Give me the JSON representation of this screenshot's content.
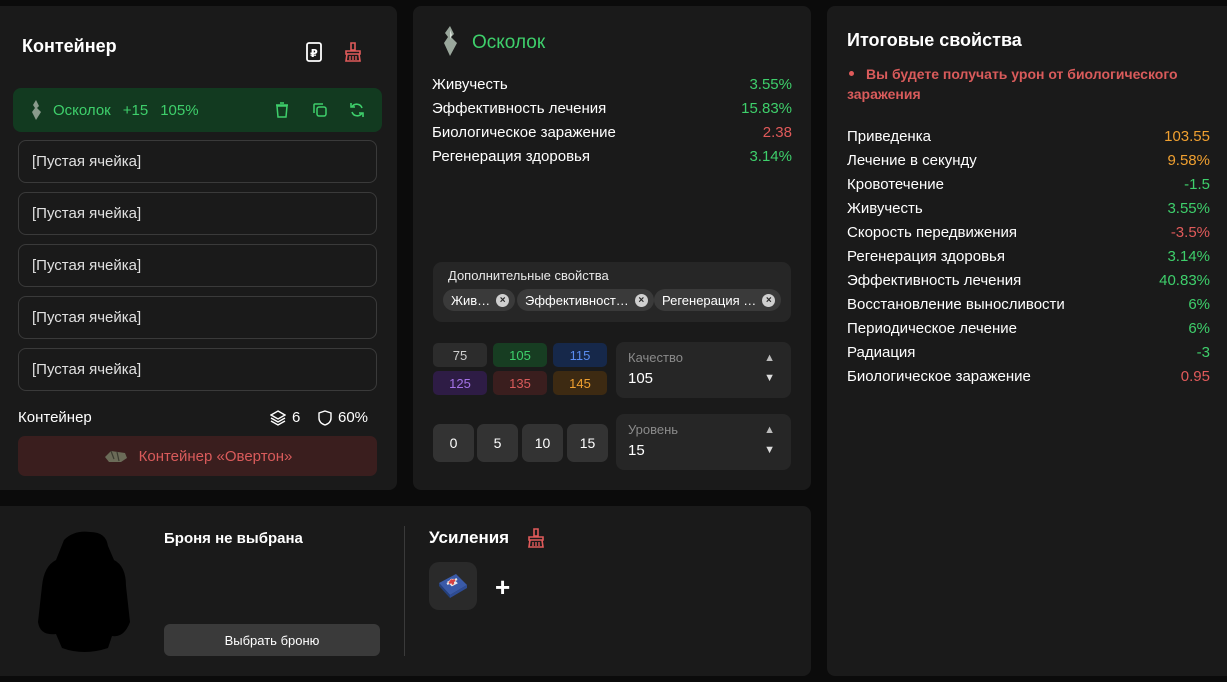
{
  "container_panel": {
    "title": "Контейнер",
    "active_slot": {
      "name": "Осколок",
      "level": "+15",
      "quality": "105%"
    },
    "empty_slots": [
      "[Пустая ячейка]",
      "[Пустая ячейка]",
      "[Пустая ячейка]",
      "[Пустая ячейка]",
      "[Пустая ячейка]"
    ],
    "footer": {
      "label": "Контейнер",
      "slots": "6",
      "protection": "60%"
    },
    "selected_container": "Контейнер «Овертон»"
  },
  "artifact_panel": {
    "title": "Осколок",
    "stats": [
      {
        "name": "Живучесть",
        "value": "3.55%",
        "color": "#3ecf6b"
      },
      {
        "name": "Эффективность лечения",
        "value": "15.83%",
        "color": "#3ecf6b"
      },
      {
        "name": "Биологическое заражение",
        "value": "2.38",
        "color": "#e05a5a"
      },
      {
        "name": "Регенерация здоровья",
        "value": "3.14%",
        "color": "#3ecf6b"
      }
    ],
    "extra_label": "Дополнительные свойства",
    "extra_chips": [
      "Жив…",
      "Эффективност…",
      "Регенерация …"
    ],
    "quality_presets": [
      {
        "label": "75",
        "bg": "#2c2c2c",
        "fg": "#cfcfcf"
      },
      {
        "label": "105",
        "bg": "#173d22",
        "fg": "#3ecf6b"
      },
      {
        "label": "115",
        "bg": "#16284a",
        "fg": "#5a8cf0"
      },
      {
        "label": "125",
        "bg": "#2e1c45",
        "fg": "#a472e6"
      },
      {
        "label": "135",
        "bg": "#3a1e1e",
        "fg": "#d95b5b"
      },
      {
        "label": "145",
        "bg": "#3d2a12",
        "fg": "#f0a030"
      }
    ],
    "quality": {
      "label": "Качество",
      "value": "105"
    },
    "level_presets": [
      "0",
      "5",
      "10",
      "15"
    ],
    "level": {
      "label": "Уровень",
      "value": "15"
    }
  },
  "summary_panel": {
    "title": "Итоговые свойства",
    "warning": "Вы будете получать урон от биологического заражения",
    "rows": [
      {
        "name": "Приведенка",
        "value": "103.55",
        "color": "#f0a030"
      },
      {
        "name": "Лечение в секунду",
        "value": "9.58%",
        "color": "#f0a030"
      },
      {
        "name": "Кровотечение",
        "value": "-1.5",
        "color": "#3ecf6b"
      },
      {
        "name": "Живучесть",
        "value": "3.55%",
        "color": "#3ecf6b"
      },
      {
        "name": "Скорость передвижения",
        "value": "-3.5%",
        "color": "#e05a5a"
      },
      {
        "name": "Регенерация здоровья",
        "value": "3.14%",
        "color": "#3ecf6b"
      },
      {
        "name": "Эффективность лечения",
        "value": "40.83%",
        "color": "#3ecf6b"
      },
      {
        "name": "Восстановление выносливости",
        "value": "6%",
        "color": "#3ecf6b"
      },
      {
        "name": "Периодическое лечение",
        "value": "6%",
        "color": "#3ecf6b"
      },
      {
        "name": "Радиация",
        "value": "-3",
        "color": "#3ecf6b"
      },
      {
        "name": "Биологическое заражение",
        "value": "0.95",
        "color": "#e05a5a"
      }
    ]
  },
  "armor_panel": {
    "no_armor": "Броня не выбрана",
    "choose_button": "Выбрать броню",
    "boosts_title": "Усиления",
    "add_symbol": "+"
  }
}
